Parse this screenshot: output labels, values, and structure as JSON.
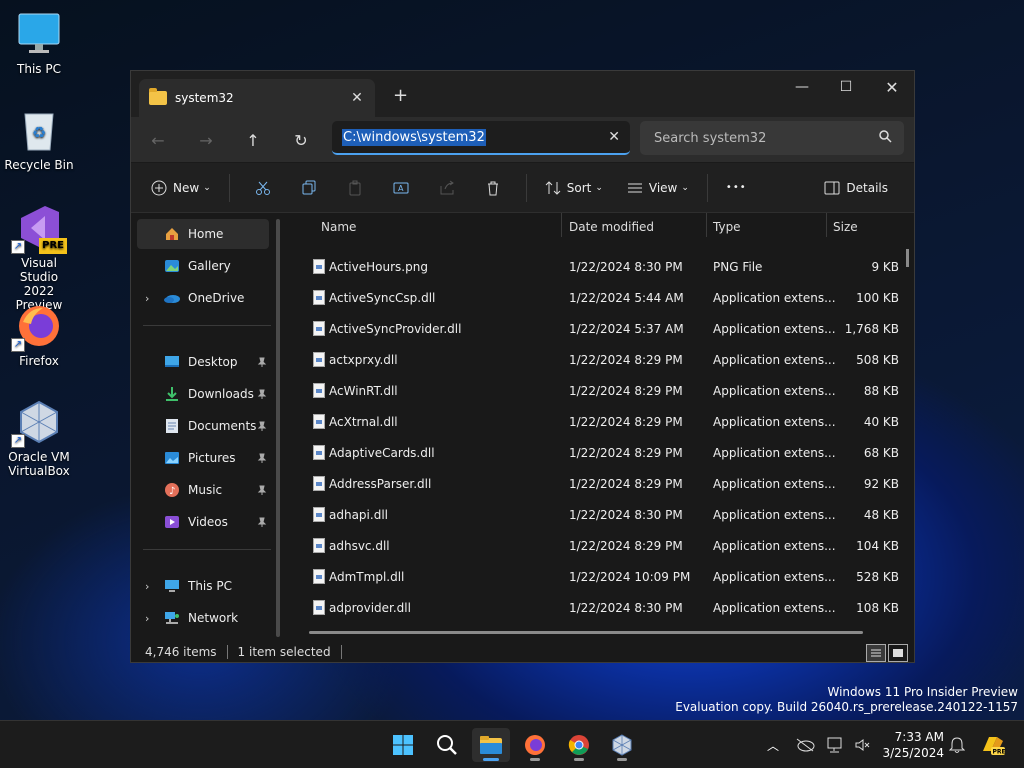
{
  "desktop": {
    "icons": [
      {
        "label_1": "This PC",
        "label_2": ""
      },
      {
        "label_1": "Recycle Bin",
        "label_2": ""
      },
      {
        "label_1": "Visual Studio",
        "label_2": "2022 Preview"
      },
      {
        "label_1": "Firefox",
        "label_2": ""
      },
      {
        "label_1": "Oracle VM",
        "label_2": "VirtualBox"
      }
    ],
    "vs_badge": "PRE"
  },
  "window": {
    "tab_title": "system32",
    "address": "C:\\windows\\system32",
    "search_placeholder": "Search system32",
    "commands": {
      "new": "New",
      "sort": "Sort",
      "view": "View",
      "more": "•••",
      "details": "Details"
    }
  },
  "nav": {
    "items": [
      {
        "label": "Home"
      },
      {
        "label": "Gallery"
      },
      {
        "label": "OneDrive"
      },
      {
        "label": "Desktop"
      },
      {
        "label": "Downloads"
      },
      {
        "label": "Documents"
      },
      {
        "label": "Pictures"
      },
      {
        "label": "Music"
      },
      {
        "label": "Videos"
      },
      {
        "label": "This PC"
      },
      {
        "label": "Network"
      }
    ]
  },
  "columns": {
    "name": "Name",
    "date": "Date modified",
    "type": "Type",
    "size": "Size"
  },
  "files": [
    {
      "name": "ActiveHours.png",
      "date": "1/22/2024 8:30 PM",
      "type": "PNG File",
      "size": "9 KB"
    },
    {
      "name": "ActiveSyncCsp.dll",
      "date": "1/22/2024 5:44 AM",
      "type": "Application extens...",
      "size": "100 KB"
    },
    {
      "name": "ActiveSyncProvider.dll",
      "date": "1/22/2024 5:37 AM",
      "type": "Application extens...",
      "size": "1,768 KB"
    },
    {
      "name": "actxprxy.dll",
      "date": "1/22/2024 8:29 PM",
      "type": "Application extens...",
      "size": "508 KB"
    },
    {
      "name": "AcWinRT.dll",
      "date": "1/22/2024 8:29 PM",
      "type": "Application extens...",
      "size": "88 KB"
    },
    {
      "name": "AcXtrnal.dll",
      "date": "1/22/2024 8:29 PM",
      "type": "Application extens...",
      "size": "40 KB"
    },
    {
      "name": "AdaptiveCards.dll",
      "date": "1/22/2024 8:29 PM",
      "type": "Application extens...",
      "size": "68 KB"
    },
    {
      "name": "AddressParser.dll",
      "date": "1/22/2024 8:29 PM",
      "type": "Application extens...",
      "size": "92 KB"
    },
    {
      "name": "adhapi.dll",
      "date": "1/22/2024 8:30 PM",
      "type": "Application extens...",
      "size": "48 KB"
    },
    {
      "name": "adhsvc.dll",
      "date": "1/22/2024 8:29 PM",
      "type": "Application extens...",
      "size": "104 KB"
    },
    {
      "name": "AdmTmpl.dll",
      "date": "1/22/2024 10:09 PM",
      "type": "Application extens...",
      "size": "528 KB"
    },
    {
      "name": "adprovider.dll",
      "date": "1/22/2024 8:30 PM",
      "type": "Application extens...",
      "size": "108 KB"
    }
  ],
  "status": {
    "count": "4,746 items",
    "selected": "1 item selected"
  },
  "watermark": {
    "line1": "Windows 11 Pro Insider Preview",
    "line2": "Evaluation copy. Build 26040.rs_prerelease.240122-1157"
  },
  "clock": {
    "time": "7:33 AM",
    "date": "3/25/2024"
  },
  "colors": {
    "accent": "#4ca2f0",
    "selection": "#1e5fb8"
  }
}
